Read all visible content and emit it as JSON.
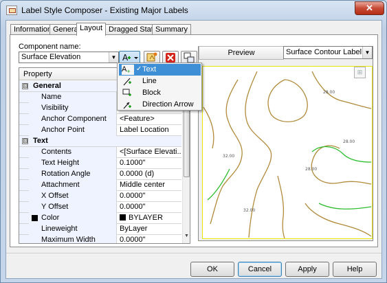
{
  "window": {
    "title": "Label Style Composer - Existing Major Labels",
    "close_label": "✕"
  },
  "tabs": [
    "Information",
    "General",
    "Layout",
    "Dragged State",
    "Summary"
  ],
  "active_tab": "Layout",
  "component": {
    "label": "Component name:",
    "value": "Surface Elevation"
  },
  "property_grid": {
    "header": "Property",
    "rows": [
      {
        "type": "group",
        "label": "General",
        "expander": "⊟"
      },
      {
        "type": "prop",
        "name": "Name",
        "value": ""
      },
      {
        "type": "prop",
        "name": "Visibility",
        "value": ""
      },
      {
        "type": "prop",
        "name": "Anchor Component",
        "value": "<Feature>"
      },
      {
        "type": "prop",
        "name": "Anchor Point",
        "value": "Label Location"
      },
      {
        "type": "group",
        "label": "Text",
        "expander": "⊟"
      },
      {
        "type": "prop",
        "name": "Contents",
        "value": "<[Surface Elevati..."
      },
      {
        "type": "prop",
        "name": "Text Height",
        "value": "0.1000\""
      },
      {
        "type": "prop",
        "name": "Rotation Angle",
        "value": "0.0000 (d)"
      },
      {
        "type": "prop",
        "name": "Attachment",
        "value": "Middle center"
      },
      {
        "type": "prop",
        "name": "X Offset",
        "value": "0.0000\""
      },
      {
        "type": "prop",
        "name": "Y Offset",
        "value": "0.0000\""
      },
      {
        "type": "prop",
        "name": "Color",
        "value": "BYLAYER",
        "swatch": true
      },
      {
        "type": "prop",
        "name": "Lineweight",
        "value": "ByLayer"
      },
      {
        "type": "prop",
        "name": "Maximum Width",
        "value": "0.0000\""
      }
    ]
  },
  "add_component_menu": {
    "items": [
      {
        "label": "Text",
        "icon": "text-component-icon",
        "selected": true
      },
      {
        "label": "Line",
        "icon": "line-component-icon",
        "selected": false
      },
      {
        "label": "Block",
        "icon": "block-component-icon",
        "selected": false
      },
      {
        "label": "Direction Arrow",
        "icon": "direction-arrow-component-icon",
        "selected": false
      }
    ]
  },
  "preview": {
    "button_label": "Preview",
    "style_value": "Surface Contour Label Styl",
    "contour_labels": [
      "28.00",
      "28.00",
      "32.00",
      "28.00",
      "32.00"
    ]
  },
  "buttons": {
    "ok": "OK",
    "cancel": "Cancel",
    "apply": "Apply",
    "help": "Help"
  },
  "colors": {
    "selection": "#3f8fd6",
    "contour_major": "#b08a3a",
    "contour_minor": "#2dbd2d",
    "preview_border": "#e8e800",
    "delete_red": "#d3261c"
  }
}
